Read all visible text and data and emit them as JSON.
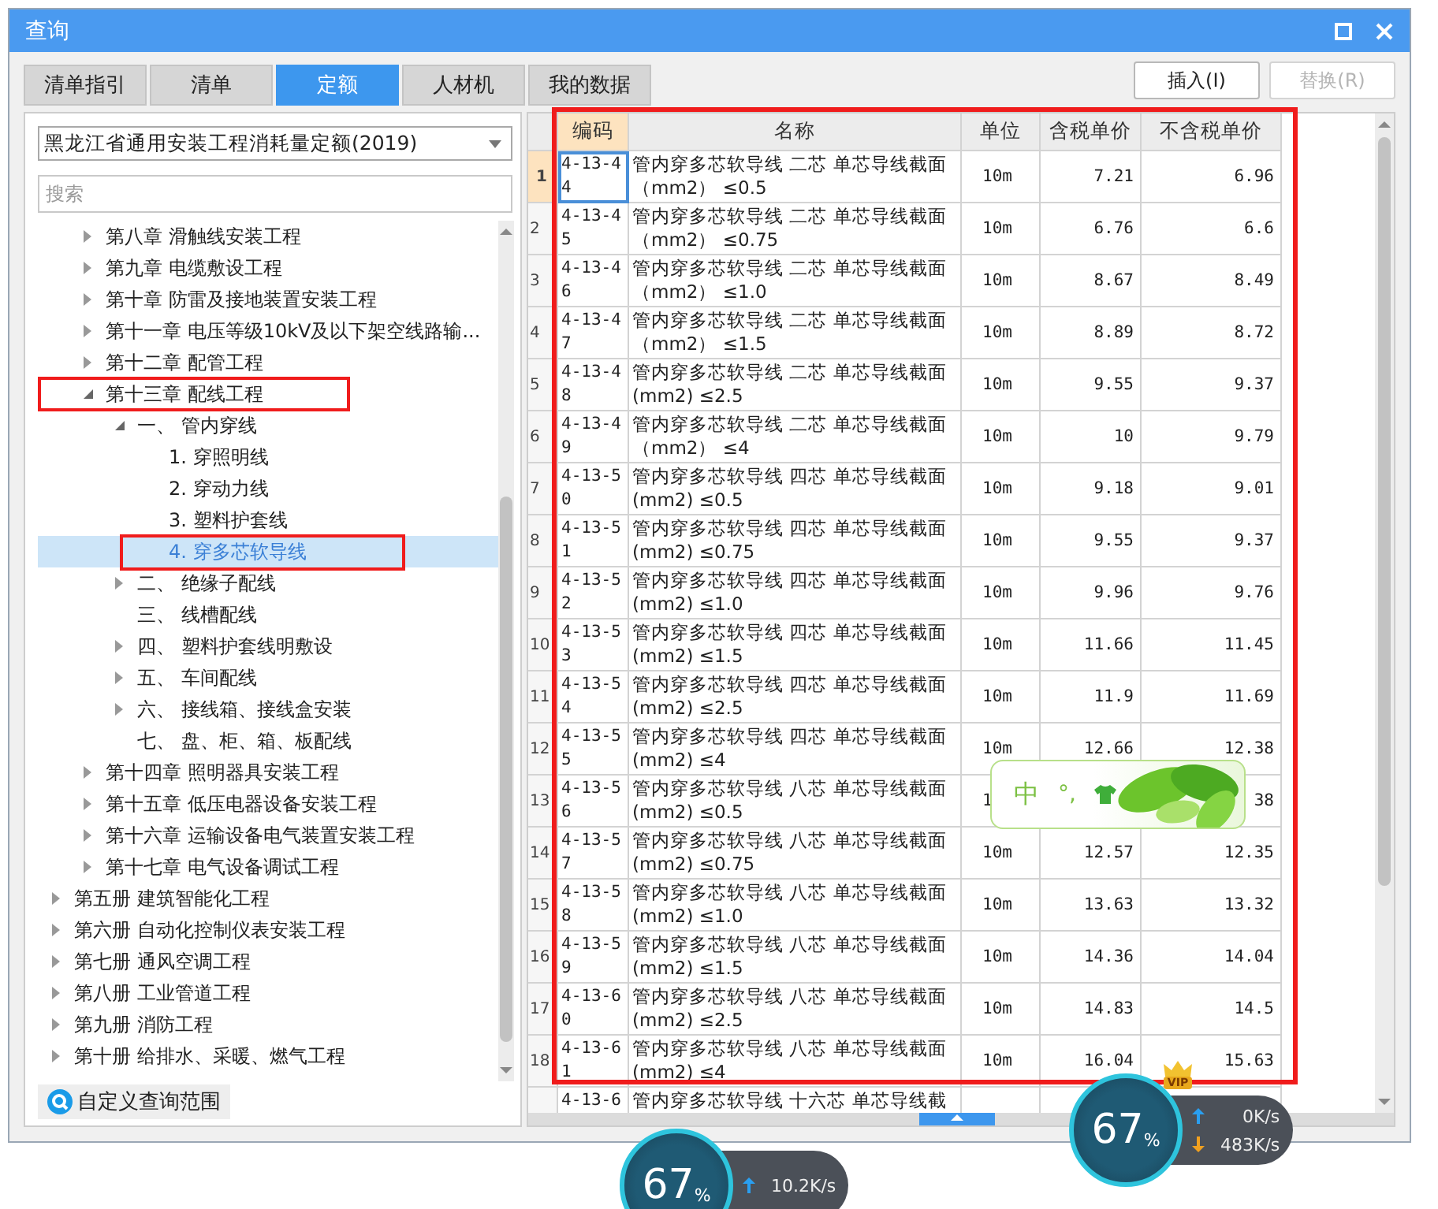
{
  "window": {
    "title": "查询"
  },
  "tabs": [
    {
      "label": "清单指引",
      "selected": false
    },
    {
      "label": "清单",
      "selected": false
    },
    {
      "label": "定额",
      "selected": true
    },
    {
      "label": "人材机",
      "selected": false
    },
    {
      "label": "我的数据",
      "selected": false
    }
  ],
  "buttons": [
    {
      "label": "插入(I)",
      "disabled": false
    },
    {
      "label": "替换(R)",
      "disabled": true
    }
  ],
  "library_select": {
    "value": "黑龙江省通用安装工程消耗量定额(2019)"
  },
  "search": {
    "placeholder": "搜索"
  },
  "tree": {
    "items": [
      {
        "children": [
          {
            "label": "第八章 滑触线安装工程",
            "expanded": false,
            "selected": false
          },
          {
            "label": "第九章 电缆敷设工程",
            "expanded": false,
            "selected": false
          },
          {
            "label": "第十章 防雷及接地装置安装工程",
            "expanded": false,
            "selected": false
          },
          {
            "label": "第十一章 电压等级10kV及以下架空线路输...",
            "expanded": false,
            "selected": false
          },
          {
            "label": "第十二章 配管工程",
            "expanded": false,
            "selected": false
          },
          {
            "label": "第十三章 配线工程",
            "expanded": true,
            "selected": false,
            "children": [
              {
                "label": "一、 管内穿线",
                "expanded": true,
                "selected": false,
                "children": [
                  {
                    "label": "1. 穿照明线",
                    "selected": false
                  },
                  {
                    "label": "2. 穿动力线",
                    "selected": false
                  },
                  {
                    "label": "3. 塑料护套线",
                    "selected": false
                  },
                  {
                    "label": "4. 穿多芯软导线",
                    "selected": true
                  }
                ]
              },
              {
                "label": "二、 绝缘子配线",
                "expanded": false,
                "selected": false
              },
              {
                "label": "三、 线槽配线",
                "selected": false
              },
              {
                "label": "四、 塑料护套线明敷设",
                "expanded": false,
                "selected": false
              },
              {
                "label": "五、 车间配线",
                "expanded": false,
                "selected": false
              },
              {
                "label": "六、 接线箱、接线盒安装",
                "expanded": false,
                "selected": false
              },
              {
                "label": "七、 盘、柜、箱、板配线",
                "selected": false
              }
            ]
          },
          {
            "label": "第十四章 照明器具安装工程",
            "expanded": false,
            "selected": false
          },
          {
            "label": "第十五章 低压电器设备安装工程",
            "expanded": false,
            "selected": false
          },
          {
            "label": "第十六章 运输设备电气装置安装工程",
            "expanded": false,
            "selected": false
          },
          {
            "label": "第十七章 电气设备调试工程",
            "expanded": false,
            "selected": false
          }
        ]
      },
      {
        "label": "第五册 建筑智能化工程",
        "expanded": false,
        "selected": false
      },
      {
        "label": "第六册 自动化控制仪表安装工程",
        "expanded": false,
        "selected": false
      },
      {
        "label": "第七册 通风空调工程",
        "expanded": false,
        "selected": false
      },
      {
        "label": "第八册 工业管道工程",
        "expanded": false,
        "selected": false
      },
      {
        "label": "第九册 消防工程",
        "expanded": false,
        "selected": false
      },
      {
        "label": "第十册 给排水、采暖、燃气工程",
        "expanded": false,
        "selected": false
      }
    ]
  },
  "custom_scope_button": {
    "label": "自定义查询范围"
  },
  "table": {
    "columns": [
      "编码",
      "名称",
      "单位",
      "含税单价",
      "不含税单价"
    ],
    "rows": [
      {
        "number": "1",
        "code": "4-13-44",
        "name": "管内穿多芯软导线 二芯 单芯导线截面（mm2） ≤0.5",
        "unit": "10m",
        "price_with_tax": "7.21",
        "price_without_tax": "6.96",
        "selected": true
      },
      {
        "number": "2",
        "code": "4-13-45",
        "name": "管内穿多芯软导线 二芯 单芯导线截面（mm2） ≤0.75",
        "unit": "10m",
        "price_with_tax": "6.76",
        "price_without_tax": "6.6",
        "selected": false
      },
      {
        "number": "3",
        "code": "4-13-46",
        "name": "管内穿多芯软导线 二芯 单芯导线截面（mm2） ≤1.0",
        "unit": "10m",
        "price_with_tax": "8.67",
        "price_without_tax": "8.49",
        "selected": false
      },
      {
        "number": "4",
        "code": "4-13-47",
        "name": "管内穿多芯软导线 二芯 单芯导线截面（mm2） ≤1.5",
        "unit": "10m",
        "price_with_tax": "8.89",
        "price_without_tax": "8.72",
        "selected": false
      },
      {
        "number": "5",
        "code": "4-13-48",
        "name": "管内穿多芯软导线 二芯 单芯导线截面(mm2) ≤2.5",
        "unit": "10m",
        "price_with_tax": "9.55",
        "price_without_tax": "9.37",
        "selected": false
      },
      {
        "number": "6",
        "code": "4-13-49",
        "name": "管内穿多芯软导线 二芯 单芯导线截面（mm2） ≤4",
        "unit": "10m",
        "price_with_tax": "10",
        "price_without_tax": "9.79",
        "selected": false
      },
      {
        "number": "7",
        "code": "4-13-50",
        "name": "管内穿多芯软导线 四芯 单芯导线截面(mm2) ≤0.5",
        "unit": "10m",
        "price_with_tax": "9.18",
        "price_without_tax": "9.01",
        "selected": false
      },
      {
        "number": "8",
        "code": "4-13-51",
        "name": "管内穿多芯软导线 四芯 单芯导线截面(mm2) ≤0.75",
        "unit": "10m",
        "price_with_tax": "9.55",
        "price_without_tax": "9.37",
        "selected": false
      },
      {
        "number": "9",
        "code": "4-13-52",
        "name": "管内穿多芯软导线 四芯 单芯导线截面(mm2) ≤1.0",
        "unit": "10m",
        "price_with_tax": "9.96",
        "price_without_tax": "9.76",
        "selected": false
      },
      {
        "number": "10",
        "code": "4-13-53",
        "name": "管内穿多芯软导线 四芯 单芯导线截面(mm2) ≤1.5",
        "unit": "10m",
        "price_with_tax": "11.66",
        "price_without_tax": "11.45",
        "selected": false
      },
      {
        "number": "11",
        "code": "4-13-54",
        "name": "管内穿多芯软导线 四芯 单芯导线截面(mm2) ≤2.5",
        "unit": "10m",
        "price_with_tax": "11.9",
        "price_without_tax": "11.69",
        "selected": false
      },
      {
        "number": "12",
        "code": "4-13-55",
        "name": "管内穿多芯软导线 四芯 单芯导线截面(mm2) ≤4",
        "unit": "10m",
        "price_with_tax": "12.66",
        "price_without_tax": "12.38",
        "selected": false
      },
      {
        "number": "13",
        "code": "4-13-56",
        "name": "管内穿多芯软导线 八芯 单芯导线截面(mm2) ≤0.5",
        "unit": "1",
        "price_without_tax": "38",
        "selected": false
      },
      {
        "number": "14",
        "code": "4-13-57",
        "name": "管内穿多芯软导线 八芯 单芯导线截面(mm2) ≤0.75",
        "unit": "10m",
        "price_with_tax": "12.57",
        "price_without_tax": "12.35",
        "selected": false
      },
      {
        "number": "15",
        "code": "4-13-58",
        "name": "管内穿多芯软导线 八芯 单芯导线截面(mm2) ≤1.0",
        "unit": "10m",
        "price_with_tax": "13.63",
        "price_without_tax": "13.32",
        "selected": false
      },
      {
        "number": "16",
        "code": "4-13-59",
        "name": "管内穿多芯软导线 八芯 单芯导线截面(mm2) ≤1.5",
        "unit": "10m",
        "price_with_tax": "14.36",
        "price_without_tax": "14.04",
        "selected": false
      },
      {
        "number": "17",
        "code": "4-13-60",
        "name": "管内穿多芯软导线 八芯 单芯导线截面(mm2) ≤2.5",
        "unit": "10m",
        "price_with_tax": "14.83",
        "price_without_tax": "14.5",
        "selected": false
      },
      {
        "number": "18",
        "code": "4-13-61",
        "name": "管内穿多芯软导线 八芯 单芯导线截面(mm2) ≤4",
        "unit": "10m",
        "price_with_tax": "16.04",
        "price_without_tax": "15.63",
        "selected": false
      },
      {
        "code": "4-13-6",
        "name": "管内穿多芯软导线 十六芯 单芯导线截",
        "selected": false
      }
    ]
  },
  "ime_bar": {
    "mode": "中",
    "punctuation": "°,"
  },
  "speed_widgets": [
    {
      "percent": "67",
      "unit": "%",
      "upload": "0K/s",
      "download": "483K/s",
      "badge": "VIP"
    },
    {
      "percent": "67",
      "unit": "%",
      "upload": "10.2K/s"
    }
  ]
}
